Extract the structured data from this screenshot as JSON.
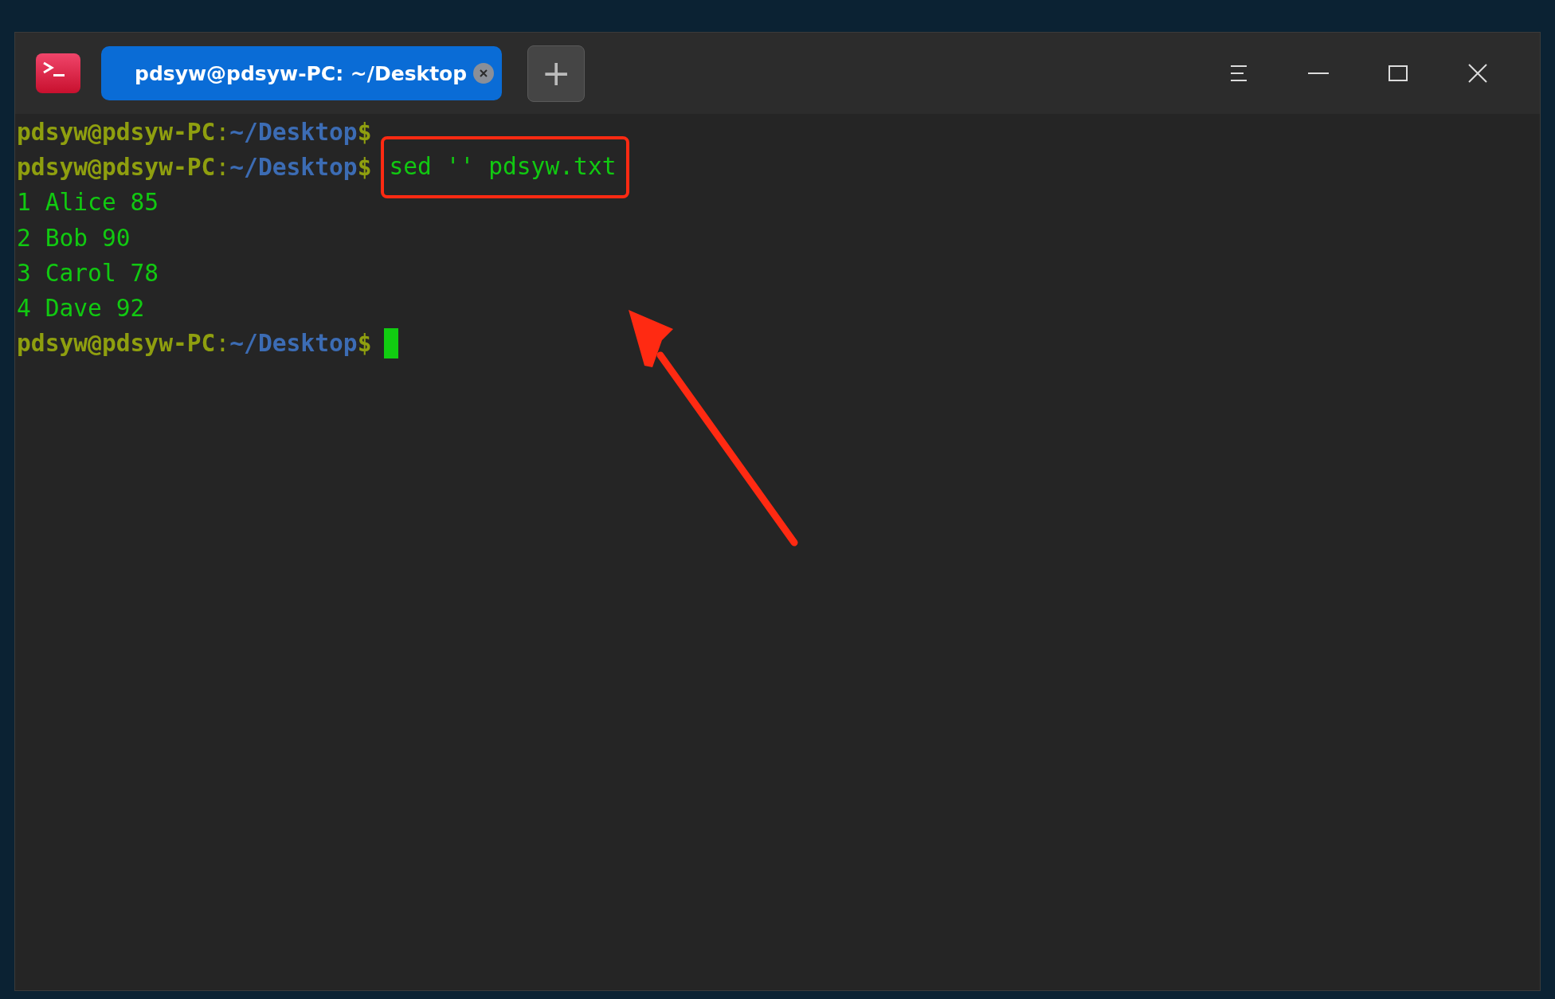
{
  "window": {
    "tabs": [
      {
        "title": "pdsyw@pdsyw-PC: ~/Desktop",
        "selected": true
      }
    ],
    "new_tab_button": "+"
  },
  "terminal": {
    "lines": [
      {
        "kind": "prompt",
        "user_host": "pdsyw@pdsyw-PC",
        "separator": ":",
        "path": "~/Desktop",
        "symbol": "$"
      },
      {
        "kind": "prompt",
        "user_host": "pdsyw@pdsyw-PC",
        "separator": ":",
        "path": "~/Desktop",
        "symbol": "$",
        "command": "sed '' pdsyw.txt",
        "highlight": true
      },
      {
        "kind": "output",
        "text": "1 Alice 85"
      },
      {
        "kind": "output",
        "text": "2 Bob 90"
      },
      {
        "kind": "output",
        "text": "3 Carol 78"
      },
      {
        "kind": "output",
        "text": "4 Dave 92"
      },
      {
        "kind": "prompt",
        "user_host": "pdsyw@pdsyw-PC",
        "separator": ":",
        "path": "~/Desktop",
        "symbol": "$",
        "cursor": true
      }
    ]
  },
  "annotation_arrow": true
}
